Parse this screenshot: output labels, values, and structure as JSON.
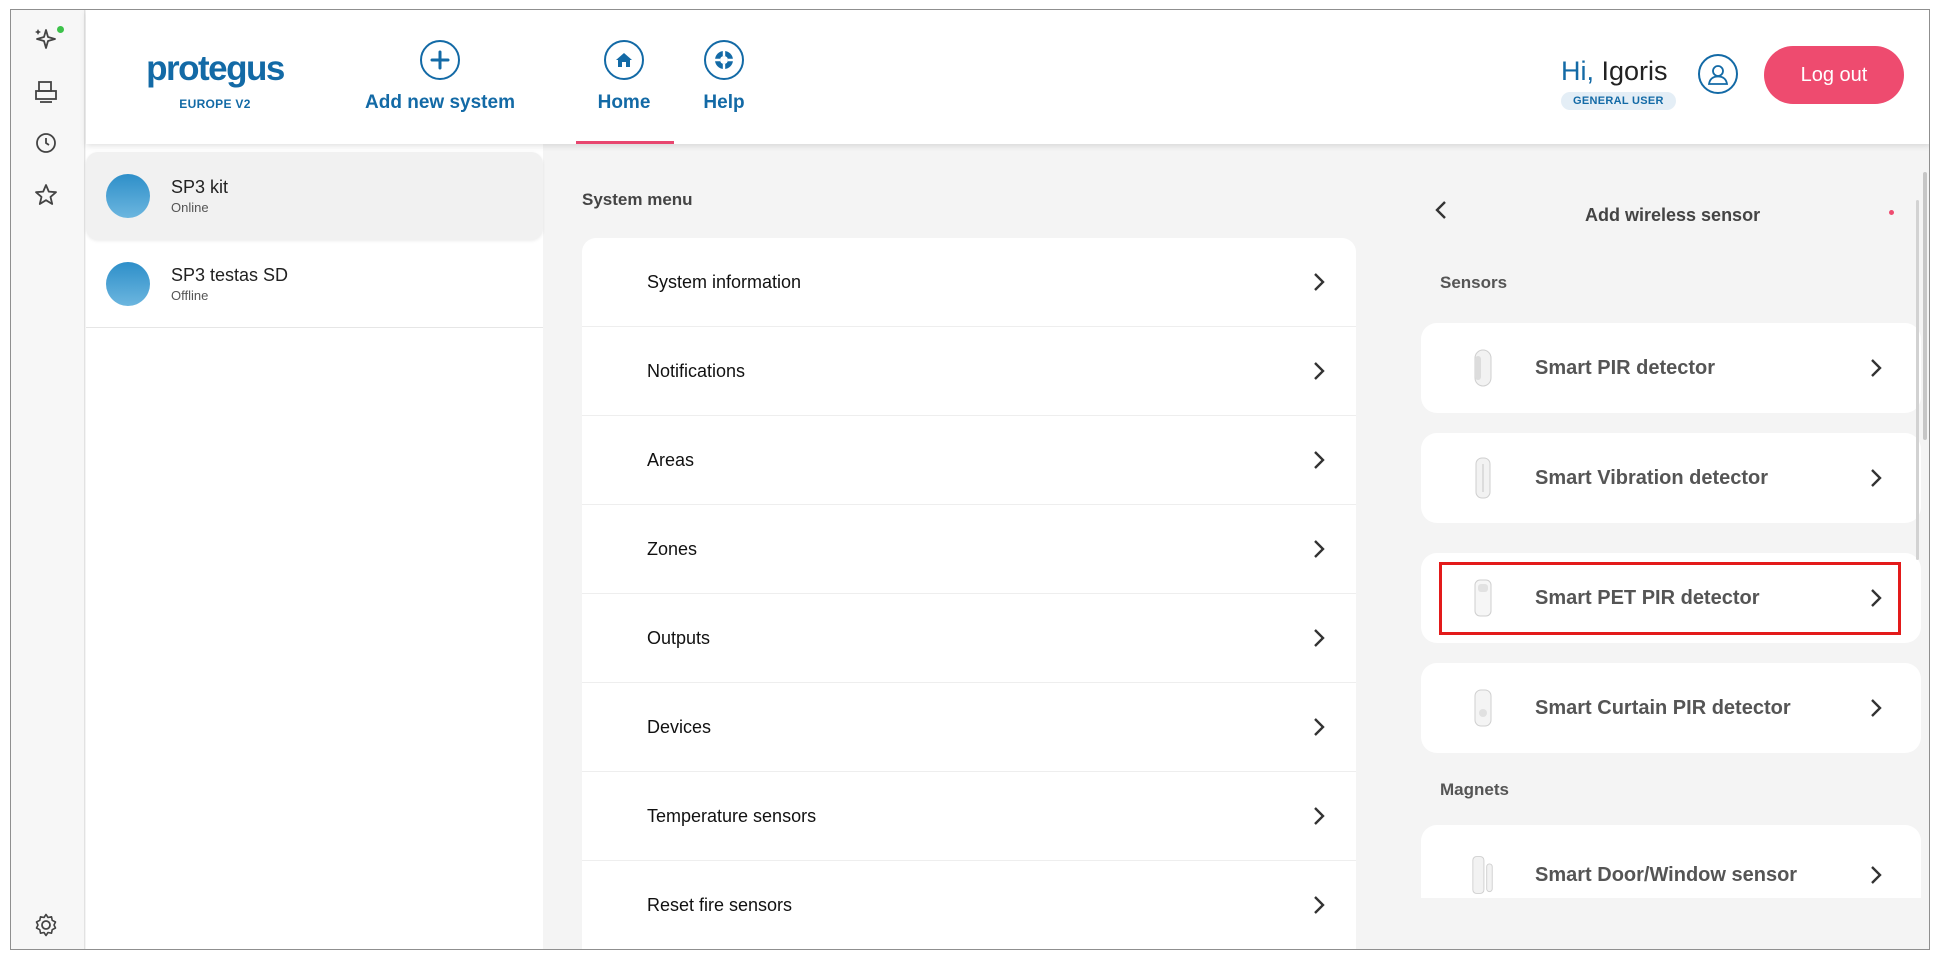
{
  "rail": {
    "icons": [
      "sparkle-icon",
      "printer-icon",
      "clock-icon",
      "star-icon",
      "settings-icon"
    ],
    "status_color": "#3cc24a"
  },
  "header": {
    "logo_text": "protegus",
    "region": "EUROPE V2",
    "add_system_label": "Add new system",
    "home_label": "Home",
    "help_label": "Help",
    "greeting_hi": "Hi,",
    "user_name": "Igoris",
    "role": "GENERAL USER",
    "logout_label": "Log out",
    "accent_color": "#136aa6",
    "logout_color": "#ee4b6f"
  },
  "systems": [
    {
      "name": "SP3 kit",
      "status": "Online",
      "active": true
    },
    {
      "name": "SP3 testas SD",
      "status": "Offline",
      "active": false
    }
  ],
  "system_menu": {
    "title": "System menu",
    "items": [
      "System information",
      "Notifications",
      "Areas",
      "Zones",
      "Outputs",
      "Devices",
      "Temperature sensors",
      "Reset fire sensors"
    ]
  },
  "wireless": {
    "title": "Add wireless sensor",
    "sections": [
      {
        "name": "Sensors",
        "items": [
          "Smart PIR detector",
          "Smart Vibration detector",
          "Smart PET PIR detector",
          "Smart Curtain PIR detector"
        ]
      },
      {
        "name": "Magnets",
        "items": [
          "Smart Door/Window sensor"
        ]
      }
    ],
    "highlighted": "Smart PET PIR detector",
    "highlight_color": "#e31a1a"
  }
}
